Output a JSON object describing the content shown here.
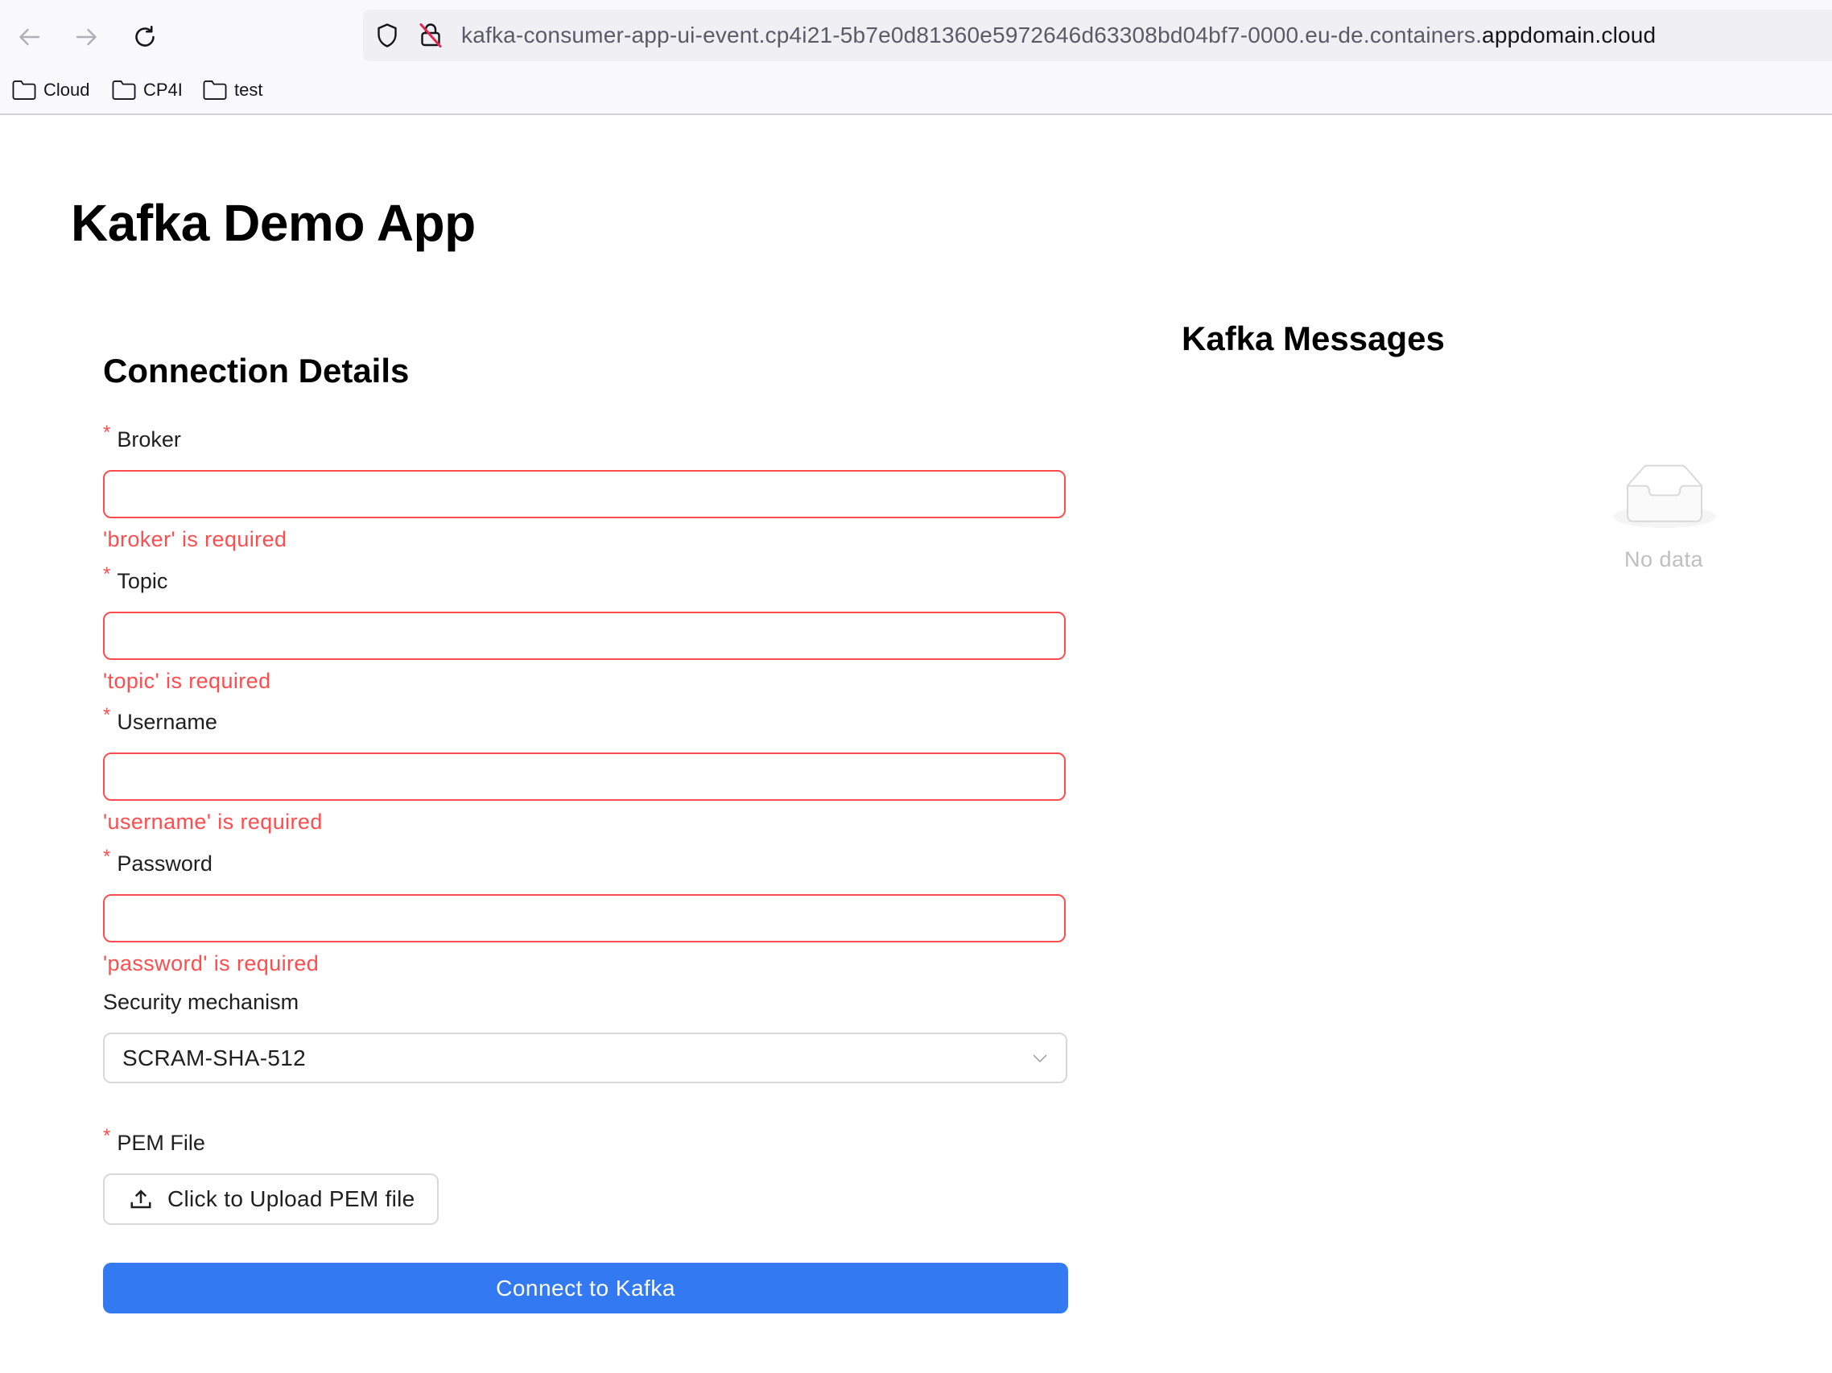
{
  "browser": {
    "url_prefix": "kafka-consumer-app-ui-event.cp4i21-5b7e0d81360e5972646d63308bd04bf7-0000.eu-de.containers.",
    "url_domain": "appdomain.cloud",
    "bookmarks": [
      "Cloud",
      "CP4I",
      "test"
    ],
    "icons": {
      "back": "back-arrow-icon",
      "forward": "forward-arrow-icon",
      "reload": "reload-icon",
      "shield": "shield-icon",
      "insecure": "insecure-lock-icon",
      "folder": "folder-icon"
    }
  },
  "page": {
    "title": "Kafka Demo App",
    "connection_title": "Connection Details",
    "messages_title": "Kafka Messages"
  },
  "form": {
    "required_mark": "*",
    "broker": {
      "label": "Broker",
      "value": "",
      "error": "'broker' is required"
    },
    "topic": {
      "label": "Topic",
      "value": "",
      "error": "'topic' is required"
    },
    "username": {
      "label": "Username",
      "value": "",
      "error": "'username' is required"
    },
    "password": {
      "label": "Password",
      "value": "",
      "error": "'password' is required"
    },
    "security": {
      "label": "Security mechanism",
      "value": "SCRAM-SHA-512"
    },
    "pem": {
      "label": "PEM File",
      "button": "Click to Upload PEM file"
    },
    "submit": "Connect to Kafka"
  },
  "messages": {
    "empty_text": "No data"
  },
  "colors": {
    "error": "#ff4d4f",
    "primary": "#3279f2",
    "border": "#d9d9d9",
    "muted": "#bfbfbf"
  }
}
